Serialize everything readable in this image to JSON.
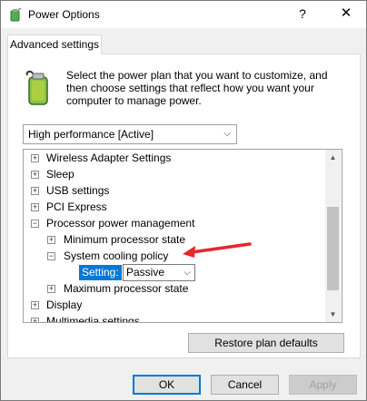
{
  "window": {
    "title": "Power Options",
    "help_glyph": "?",
    "close_glyph": "✕"
  },
  "tab": {
    "label": "Advanced settings"
  },
  "description": "Select the power plan that you want to customize, and then choose settings that reflect how you want your computer to manage power.",
  "plan": {
    "selected": "High performance [Active]"
  },
  "tree": {
    "items": [
      {
        "label": "Wireless Adapter Settings",
        "expander": "+"
      },
      {
        "label": "Sleep",
        "expander": "+"
      },
      {
        "label": "USB settings",
        "expander": "+"
      },
      {
        "label": "PCI Express",
        "expander": "+"
      },
      {
        "label": "Processor power management",
        "expander": "−"
      },
      {
        "label": "Minimum processor state",
        "expander": "+"
      },
      {
        "label": "System cooling policy",
        "expander": "−"
      },
      {
        "label": "Maximum processor state",
        "expander": "+"
      },
      {
        "label": "Display",
        "expander": "+"
      },
      {
        "label": "Multimedia settings",
        "expander": "+"
      }
    ],
    "setting_label": "Setting:",
    "setting_value": "Passive"
  },
  "buttons": {
    "restore": "Restore plan defaults",
    "ok": "OK",
    "cancel": "Cancel",
    "apply": "Apply"
  },
  "colors": {
    "accent": "#0078d7",
    "arrow": "#e8262b"
  },
  "icons": {
    "title": "power-options-icon",
    "battery": "battery-plug-icon"
  }
}
